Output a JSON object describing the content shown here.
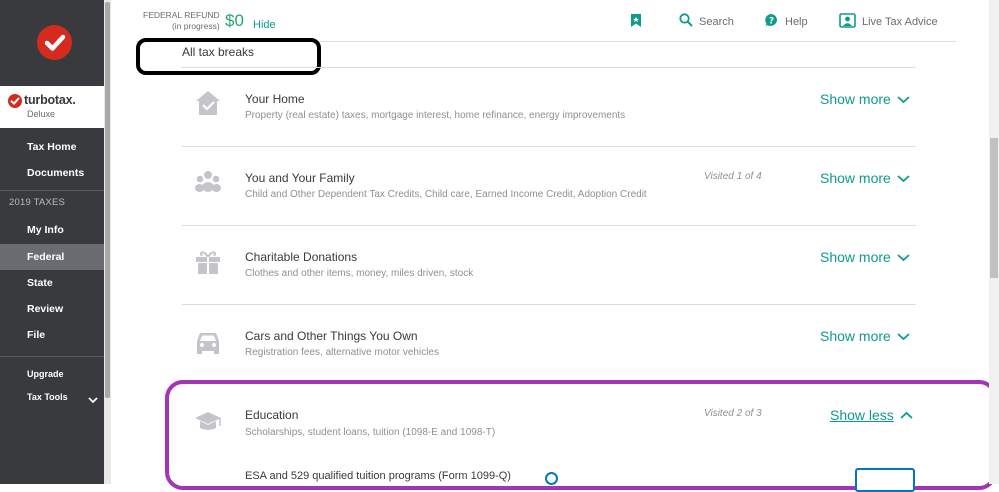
{
  "sidebar": {
    "brand_name": "turbotax.",
    "brand_edition": "Deluxe",
    "nav_top": [
      "Tax Home",
      "Documents"
    ],
    "section_title": "2019 TAXES",
    "nav_taxes": [
      "My Info",
      "Federal",
      "State",
      "Review",
      "File"
    ],
    "active_item": "Federal",
    "upgrade": "Upgrade",
    "tax_tools": "Tax Tools"
  },
  "header": {
    "refund_label_1": "FEDERAL REFUND",
    "refund_label_2": "(in progress)",
    "refund_amount": "$0",
    "hide": "Hide",
    "search": "Search",
    "help": "Help",
    "live_advice": "Live Tax Advice"
  },
  "main": {
    "all_tax_breaks": "All tax breaks",
    "categories": [
      {
        "title": "Your Home",
        "desc": "Property (real estate) taxes, mortgage interest, home refinance, energy improvements",
        "visited": "",
        "toggle": "Show more"
      },
      {
        "title": "You and Your Family",
        "desc": "Child and Other Dependent Tax Credits, Child care, Earned Income Credit, Adoption Credit",
        "visited": "Visited 1 of 4",
        "toggle": "Show more"
      },
      {
        "title": "Charitable Donations",
        "desc": "Clothes and other items, money, miles driven, stock",
        "visited": "",
        "toggle": "Show more"
      },
      {
        "title": "Cars and Other Things You Own",
        "desc": "Registration fees, alternative motor vehicles",
        "visited": "",
        "toggle": "Show more"
      },
      {
        "title": "Education",
        "desc": "Scholarships, student loans, tuition (1098-E and 1098-T)",
        "visited": "Visited 2 of 3",
        "toggle": "Show less"
      }
    ],
    "sub_item": "ESA and 529 qualified tuition programs (Form 1099-Q)"
  },
  "colors": {
    "accent": "#0d9b8e",
    "refund_green": "#21a86b",
    "sidebar": "#393a3d",
    "callout_purple": "#a334b5",
    "brand_red": "#d52b1e"
  }
}
